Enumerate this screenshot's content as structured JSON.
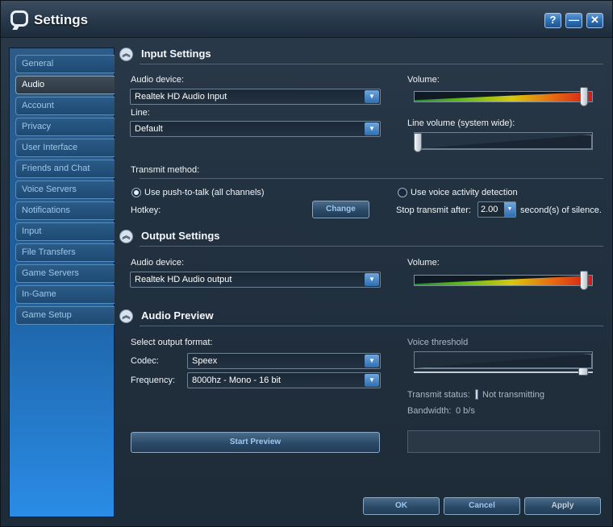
{
  "window": {
    "title": "Settings",
    "buttons": {
      "help": "?",
      "minimize": "—",
      "close": "✕"
    }
  },
  "sidebar": {
    "items": [
      {
        "label": "General"
      },
      {
        "label": "Audio",
        "active": true
      },
      {
        "label": "Account"
      },
      {
        "label": "Privacy"
      },
      {
        "label": "User Interface"
      },
      {
        "label": "Friends and Chat"
      },
      {
        "label": "Voice Servers"
      },
      {
        "label": "Notifications"
      },
      {
        "label": "Input"
      },
      {
        "label": "File Transfers"
      },
      {
        "label": "Game Servers"
      },
      {
        "label": "In-Game"
      },
      {
        "label": "Game Setup"
      }
    ]
  },
  "input_settings": {
    "heading": "Input Settings",
    "audio_device_label": "Audio device:",
    "audio_device_value": "Realtek HD Audio Input",
    "line_label": "Line:",
    "line_value": "Default",
    "volume_label": "Volume:",
    "volume_level": 0.97,
    "line_volume_label": "Line volume (system wide):",
    "line_volume_level": 0.0,
    "transmit_method_label": "Transmit method:",
    "ptt_label": "Use push-to-talk (all channels)",
    "ptt_selected": true,
    "vad_label": "Use voice activity detection",
    "vad_selected": false,
    "hotkey_label": "Hotkey:",
    "change_button": "Change",
    "stop_transmit_label": "Stop transmit after:",
    "stop_transmit_value": "2.00",
    "silence_label": "second(s) of silence."
  },
  "output_settings": {
    "heading": "Output Settings",
    "audio_device_label": "Audio device:",
    "audio_device_value": "Realtek HD Audio output",
    "volume_label": "Volume:",
    "volume_level": 0.97
  },
  "audio_preview": {
    "heading": "Audio Preview",
    "select_format_label": "Select output format:",
    "codec_label": "Codec:",
    "codec_value": "Speex",
    "frequency_label": "Frequency:",
    "frequency_value": "8000hz - Mono - 16 bit",
    "voice_threshold_label": "Voice threshold",
    "voice_threshold_level": 0.97,
    "transmit_status_label": "Transmit status:",
    "transmit_status_value": "Not transmitting",
    "bandwidth_label": "Bandwidth:",
    "bandwidth_value": "0 b/s",
    "start_preview_button": "Start Preview"
  },
  "footer": {
    "ok_button": "OK",
    "cancel_button": "Cancel",
    "apply_button": "Apply"
  },
  "colors": {
    "accent": "#2e6eb0",
    "button_text": "#9cc8f0",
    "sidebar_gradient_end": "#2a8ce6"
  }
}
